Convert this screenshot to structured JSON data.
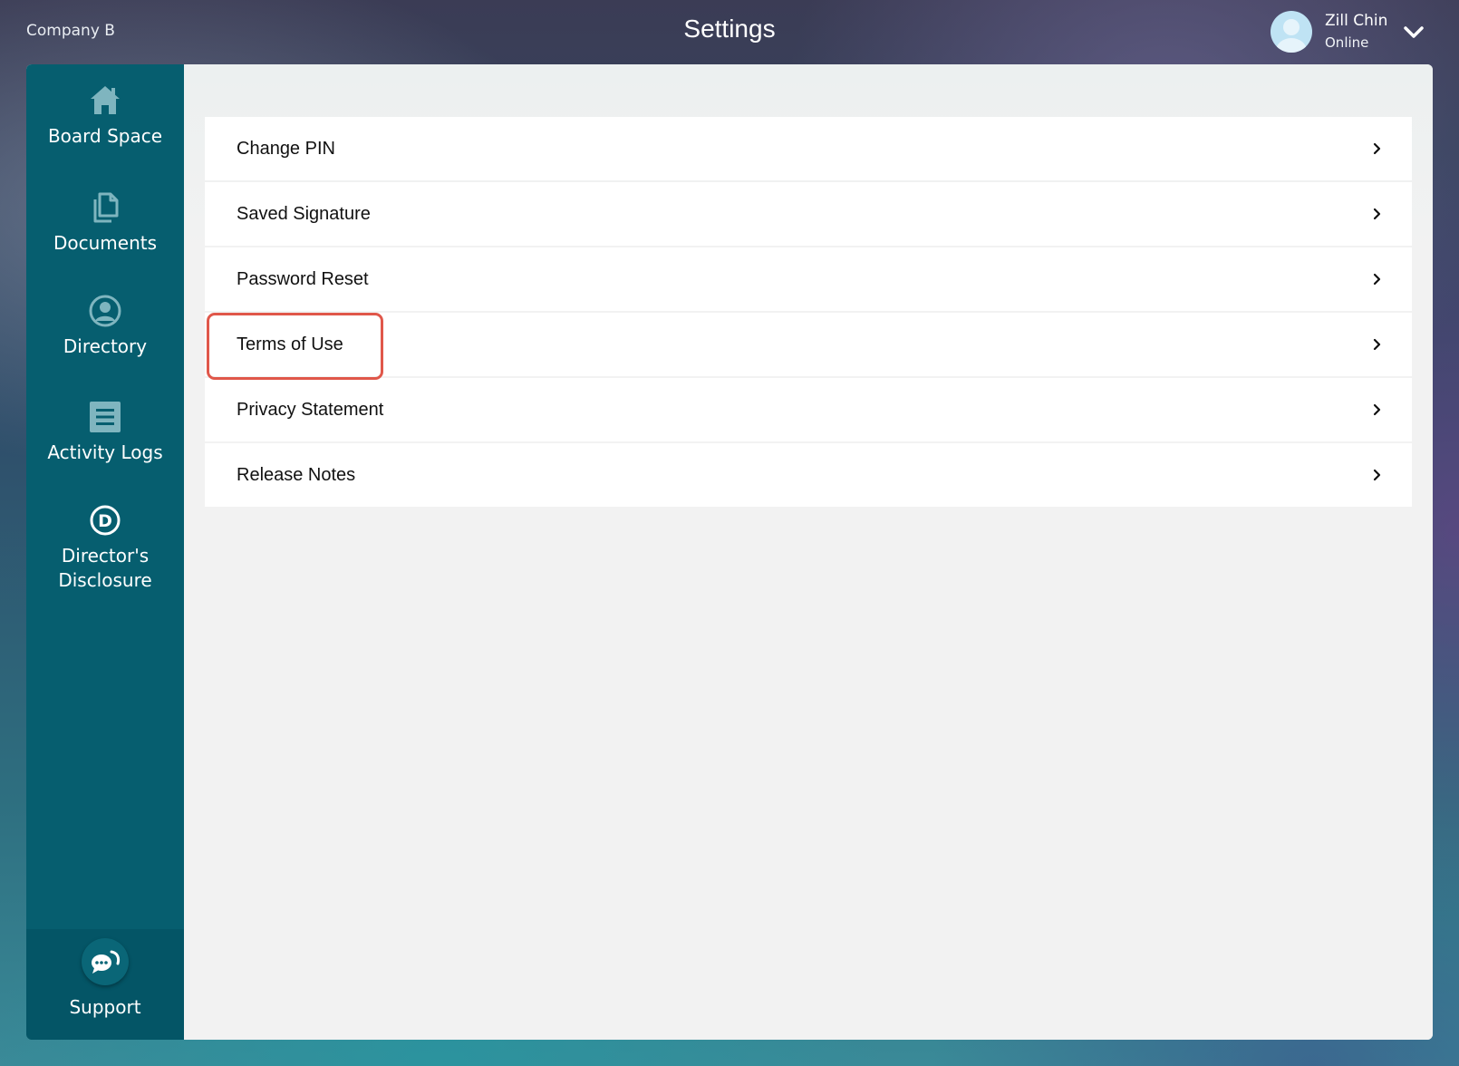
{
  "header": {
    "company": "Company B",
    "title": "Settings",
    "user": {
      "name": "Zill Chin",
      "status": "Online"
    }
  },
  "sidebar": {
    "items": [
      {
        "label": "Board Space",
        "icon": "home-icon"
      },
      {
        "label": "Documents",
        "icon": "documents-icon"
      },
      {
        "label": "Directory",
        "icon": "person-icon"
      },
      {
        "label": "Activity Logs",
        "icon": "list-icon"
      },
      {
        "label": "Director's Disclosure",
        "label_line1": "Director's",
        "label_line2": "Disclosure",
        "icon": "d-circle-icon"
      }
    ],
    "support": {
      "label": "Support",
      "icon": "support-chat-icon"
    }
  },
  "settings": {
    "items": [
      {
        "label": "Change PIN"
      },
      {
        "label": "Saved Signature"
      },
      {
        "label": "Password Reset"
      },
      {
        "label": "Terms of Use",
        "highlighted": true
      },
      {
        "label": "Privacy Statement"
      },
      {
        "label": "Release Notes"
      }
    ]
  },
  "colors": {
    "sidebar": "#065e6f",
    "highlight": "#e0574a",
    "icon": "#7fb5bf"
  }
}
